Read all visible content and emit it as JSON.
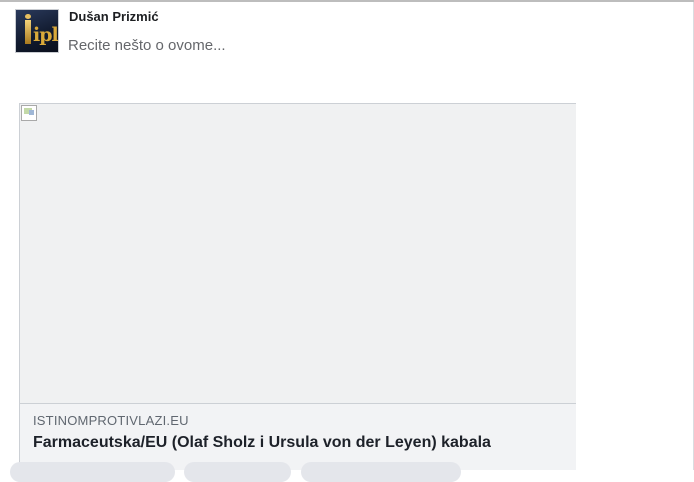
{
  "post": {
    "author_name": "Dušan Prizmić",
    "composer_placeholder": "Recite nešto o ovome...",
    "avatar_text": "ipl"
  },
  "link_preview": {
    "domain": "ISTINOMPROTIVLAZI.EU",
    "title": "Farmaceutska/EU (Olaf Sholz i Ursula von der Leyen) kabala"
  },
  "colors": {
    "border": "#ccd0d5",
    "preview_background": "#f2f3f5",
    "title_text": "#1d2129",
    "meta_text": "#606770"
  }
}
